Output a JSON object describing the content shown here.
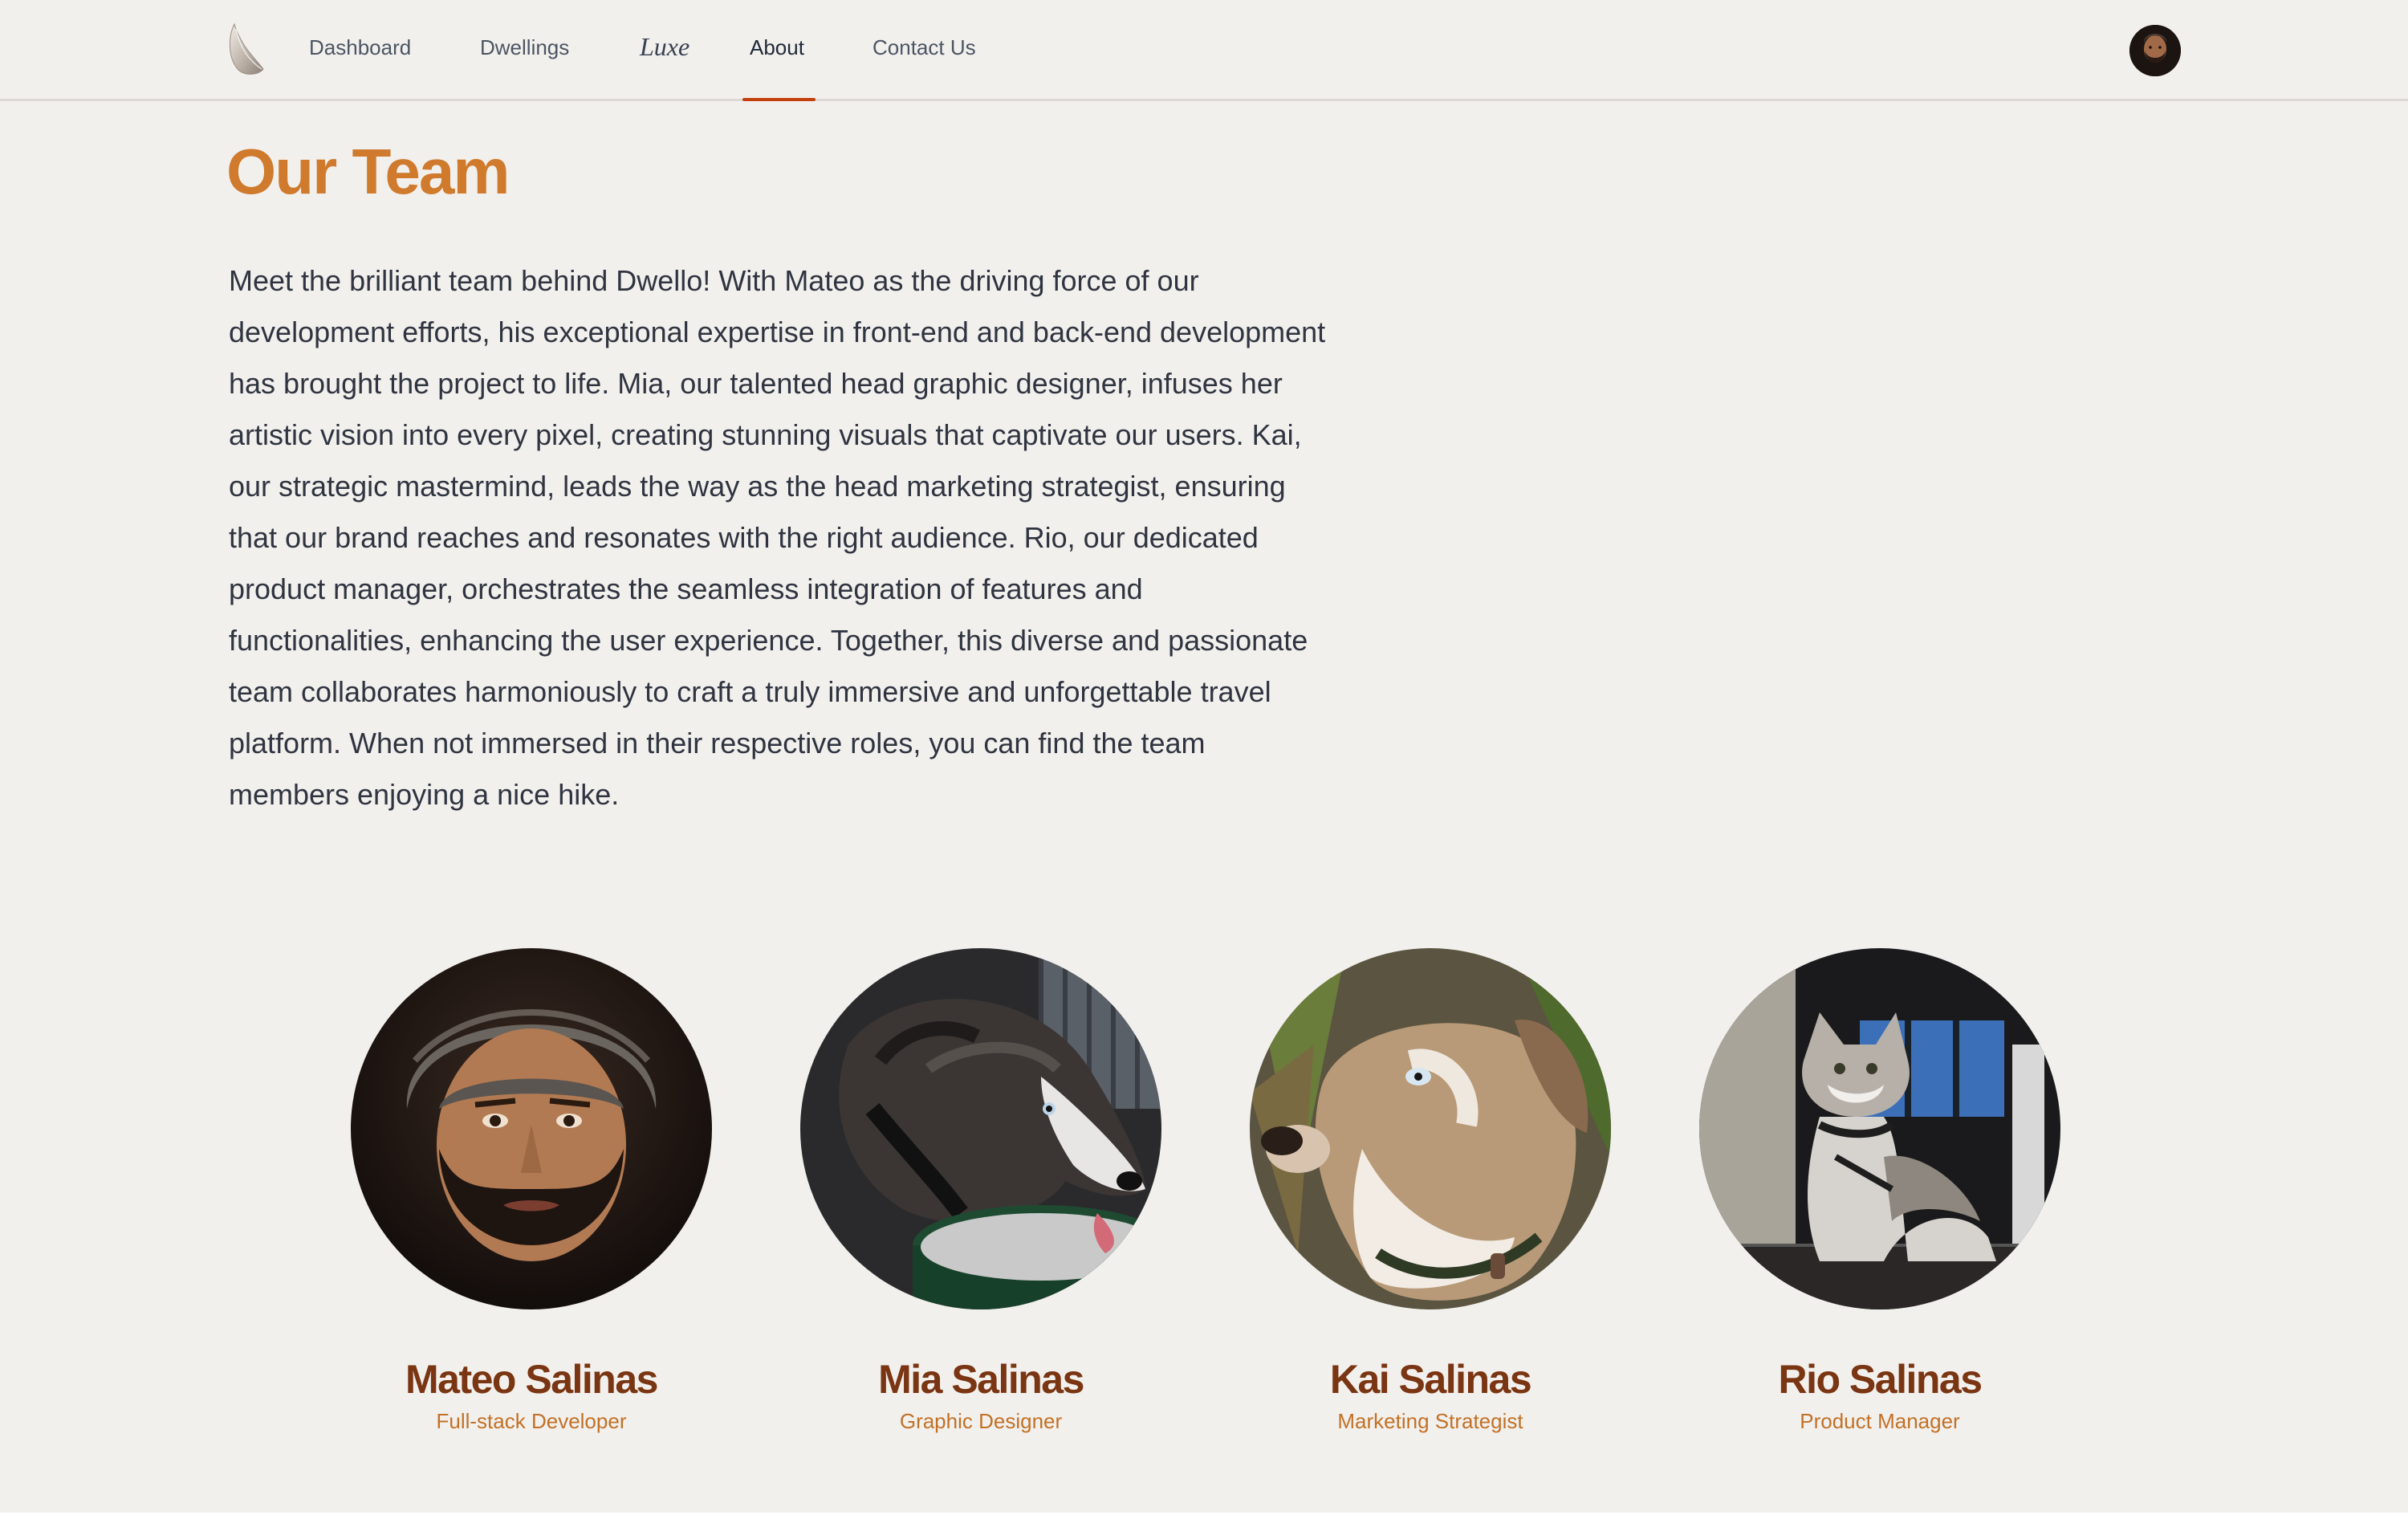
{
  "nav": {
    "items": [
      {
        "label": "Dashboard"
      },
      {
        "label": "Dwellings"
      },
      {
        "label": "Luxe"
      },
      {
        "label": "About"
      },
      {
        "label": "Contact Us"
      }
    ],
    "active": "About",
    "logo_icon": "feather-logo-icon",
    "profile_icon": "user-avatar"
  },
  "page": {
    "title": "Our Team",
    "intro": "Meet the brilliant team behind Dwello! With Mateo as the driving force of our development efforts, his exceptional expertise in front-end and back-end development has brought the project to life. Mia, our talented head graphic designer, infuses her artistic vision into every pixel, creating stunning visuals that captivate our users. Kai, our strategic mastermind, leads the way as the head marketing strategist, ensuring that our brand reaches and resonates with the right audience. Rio, our dedicated product manager, orchestrates the seamless integration of features and functionalities, enhancing the user experience. Together, this diverse and passionate team collaborates harmoniously to craft a truly immersive and unforgettable travel platform. When not immersed in their respective roles, you can find the team members enjoying a nice hike."
  },
  "team": [
    {
      "name": "Mateo Salinas",
      "role": "Full-stack Developer"
    },
    {
      "name": "Mia Salinas",
      "role": "Graphic Designer"
    },
    {
      "name": "Kai Salinas",
      "role": "Marketing Strategist"
    },
    {
      "name": "Rio Salinas",
      "role": "Product Manager"
    }
  ],
  "colors": {
    "background": "#f2f0ed",
    "title": "#cf7a2c",
    "name": "#7a3512",
    "role": "#c27126",
    "active_underline": "#c2410c"
  }
}
